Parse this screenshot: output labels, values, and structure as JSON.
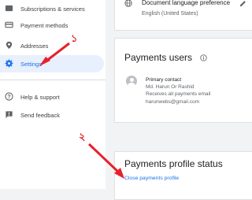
{
  "sidebar": {
    "items": [
      {
        "label": "Subscriptions & services",
        "icon": "subscriptions-icon"
      },
      {
        "label": "Payment methods",
        "icon": "credit-card-icon"
      },
      {
        "label": "Addresses",
        "icon": "location-pin-icon"
      },
      {
        "label": "Settings",
        "icon": "gear-icon",
        "active": true
      },
      {
        "label": "Help & support",
        "icon": "help-icon"
      },
      {
        "label": "Send feedback",
        "icon": "feedback-icon"
      }
    ]
  },
  "language_card": {
    "title": "Document language preference",
    "value": "English (United States)",
    "icons": [
      "globe-icon",
      "edit-pencil-icon"
    ]
  },
  "users_card": {
    "title": "Payments users",
    "info_icon": "info-icon",
    "user": {
      "role": "Primary contact",
      "name": "Md. Harun Or Rashid",
      "receives": "Receives all payments email",
      "email": "harunwebs@gmail.com"
    }
  },
  "profile_card": {
    "title": "Payments profile status",
    "close_link": "Close payments profile"
  },
  "annotations": {
    "one": "১",
    "two": "২"
  },
  "colors": {
    "accent": "#1a73e8",
    "active_bg": "#e8f0fe",
    "arrow": "#e8212a"
  }
}
